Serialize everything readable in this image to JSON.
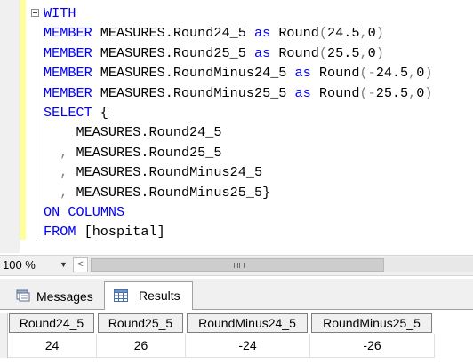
{
  "editor": {
    "lines": [
      [
        {
          "t": "WITH",
          "c": "kw"
        }
      ],
      [
        {
          "t": "MEMBER",
          "c": "kw"
        },
        {
          "t": " MEASURES.Round24_5 "
        },
        {
          "t": "as",
          "c": "kw"
        },
        {
          "t": " Round"
        },
        {
          "t": "(",
          "c": "op"
        },
        {
          "t": "24.5"
        },
        {
          "t": ",",
          "c": "op"
        },
        {
          "t": "0"
        },
        {
          "t": ")",
          "c": "op"
        }
      ],
      [
        {
          "t": "MEMBER",
          "c": "kw"
        },
        {
          "t": " MEASURES.Round25_5 "
        },
        {
          "t": "as",
          "c": "kw"
        },
        {
          "t": " Round"
        },
        {
          "t": "(",
          "c": "op"
        },
        {
          "t": "25.5"
        },
        {
          "t": ",",
          "c": "op"
        },
        {
          "t": "0"
        },
        {
          "t": ")",
          "c": "op"
        }
      ],
      [
        {
          "t": "MEMBER",
          "c": "kw"
        },
        {
          "t": " MEASURES.RoundMinus24_5 "
        },
        {
          "t": "as",
          "c": "kw"
        },
        {
          "t": " Round"
        },
        {
          "t": "(-",
          "c": "op"
        },
        {
          "t": "24.5"
        },
        {
          "t": ",",
          "c": "op"
        },
        {
          "t": "0"
        },
        {
          "t": ")",
          "c": "op"
        }
      ],
      [
        {
          "t": "MEMBER",
          "c": "kw"
        },
        {
          "t": " MEASURES.RoundMinus25_5 "
        },
        {
          "t": "as",
          "c": "kw"
        },
        {
          "t": " Round"
        },
        {
          "t": "(-",
          "c": "op"
        },
        {
          "t": "25.5"
        },
        {
          "t": ",",
          "c": "op"
        },
        {
          "t": "0"
        },
        {
          "t": ")",
          "c": "op"
        }
      ],
      [
        {
          "t": "SELECT",
          "c": "kw"
        },
        {
          "t": " {"
        }
      ],
      [
        {
          "t": "    MEASURES.Round24_5"
        }
      ],
      [
        {
          "t": "  "
        },
        {
          "t": ",",
          "c": "op"
        },
        {
          "t": " MEASURES.Round25_5"
        }
      ],
      [
        {
          "t": "  "
        },
        {
          "t": ",",
          "c": "op"
        },
        {
          "t": " MEASURES.RoundMinus24_5"
        }
      ],
      [
        {
          "t": "  "
        },
        {
          "t": ",",
          "c": "op"
        },
        {
          "t": " MEASURES.RoundMinus25_5}"
        }
      ],
      [
        {
          "t": "ON",
          "c": "kw"
        },
        {
          "t": " "
        },
        {
          "t": "COLUMNS",
          "c": "kw"
        }
      ],
      [
        {
          "t": "FROM",
          "c": "kw"
        },
        {
          "t": " [hospital]"
        }
      ]
    ]
  },
  "status": {
    "zoom": "100 %"
  },
  "results": {
    "tabs": {
      "messages": "Messages",
      "results": "Results"
    },
    "columns": [
      "Round24_5",
      "Round25_5",
      "RoundMinus24_5",
      "RoundMinus25_5"
    ],
    "rows": [
      [
        "24",
        "26",
        "-24",
        "-26"
      ]
    ]
  },
  "colors": {
    "keyword": "#0000ff",
    "function": "#ff00ff",
    "operator": "#808080",
    "change_margin": "#ffff99"
  }
}
